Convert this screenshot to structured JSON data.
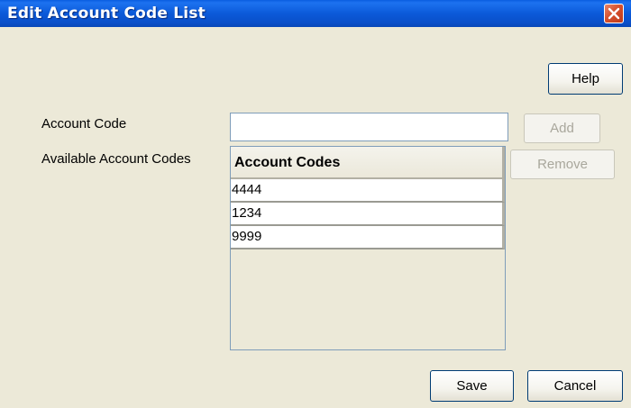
{
  "window": {
    "title": "Edit Account Code List"
  },
  "toolbar": {
    "help_label": "Help"
  },
  "form": {
    "account_code_label": "Account Code",
    "account_code_value": "",
    "available_label": "Available Account Codes",
    "add_label": "Add",
    "remove_label": "Remove"
  },
  "table": {
    "header": "Account Codes",
    "rows": [
      "4444",
      "1234",
      "9999"
    ]
  },
  "footer": {
    "save_label": "Save",
    "cancel_label": "Cancel"
  },
  "colors": {
    "titlebar": "#0a5ee0",
    "window_bg": "#ece9d8",
    "close_button": "#d6512d",
    "button_border": "#003c74",
    "disabled_text": "#a9a79c"
  },
  "icons": {
    "close": "close-icon"
  }
}
